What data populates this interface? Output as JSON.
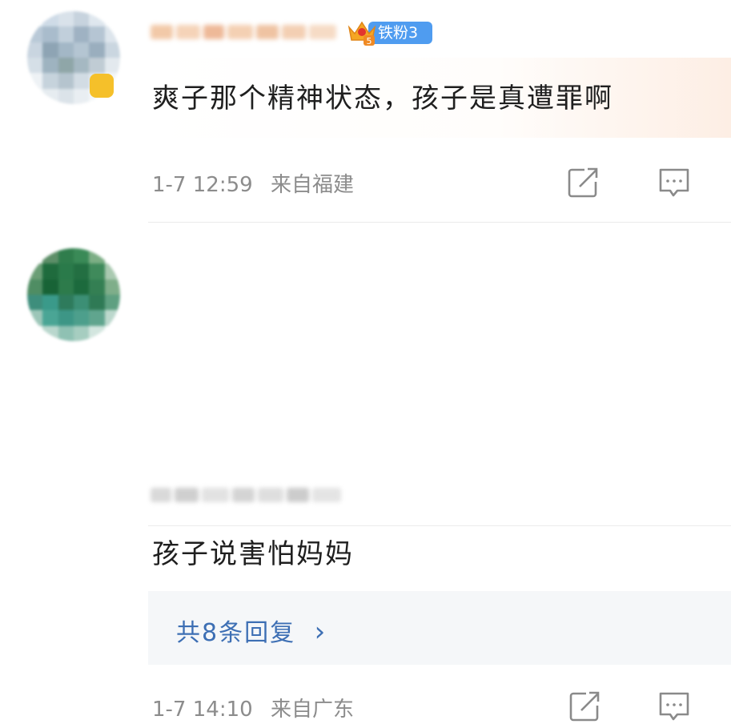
{
  "comments": [
    {
      "fan_badge": "铁粉3",
      "crown_level": "5",
      "text": "爽子那个精神状态，孩子是真遭罪啊",
      "time": "1-7 12:59",
      "location": "来自福建"
    },
    {
      "text": "孩子说害怕妈妈",
      "replies_label": "共8条回复",
      "replies_chevron": "›",
      "time": "1-7 14:10",
      "location": "来自广东"
    }
  ],
  "icons": {
    "share": "share-icon",
    "reply": "comment-icon",
    "crown": "crown-icon"
  },
  "colors": {
    "fan_badge": "#4f9cf0",
    "reply_link": "#3d6fb4",
    "meta": "#8c8c8c"
  }
}
